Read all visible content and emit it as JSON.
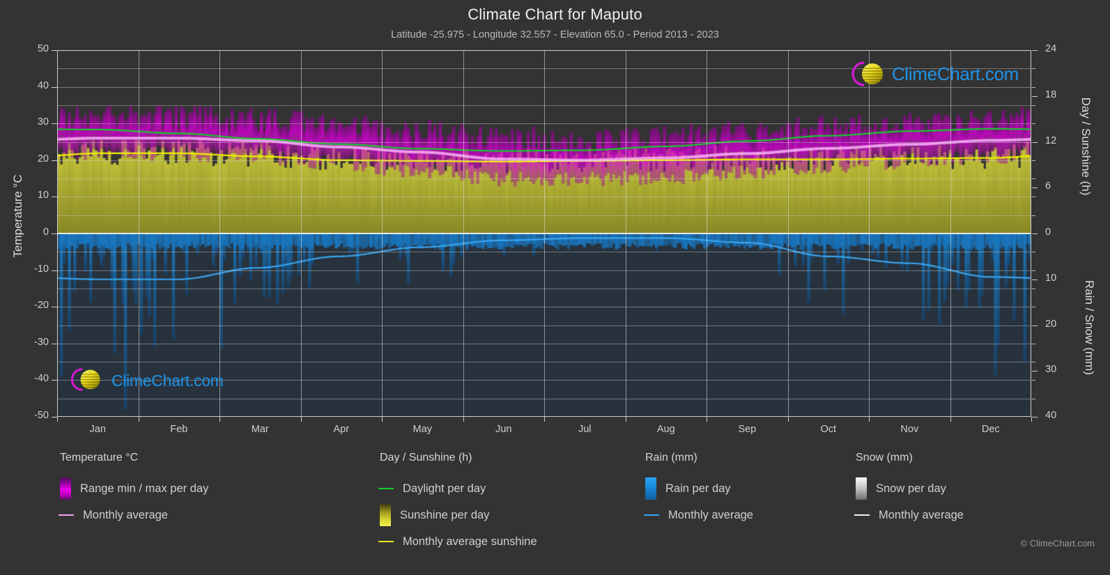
{
  "header": {
    "title": "Climate Chart for Maputo",
    "subtitle": "Latitude -25.975 - Longitude 32.557 - Elevation 65.0 - Period 2013 - 2023"
  },
  "watermark": {
    "text": "ClimeChart.com"
  },
  "copyright": "© ClimeChart.com",
  "axes": {
    "left_label": "Temperature °C",
    "right_label_top": "Day / Sunshine (h)",
    "right_label_bottom": "Rain / Snow (mm)",
    "left_ticks": [
      "50",
      "40",
      "30",
      "20",
      "10",
      "0",
      "-10",
      "-20",
      "-30",
      "-40",
      "-50"
    ],
    "right_ticks_top": [
      "24",
      "18",
      "12",
      "6",
      "0"
    ],
    "right_ticks_bottom": [
      "10",
      "20",
      "30",
      "40"
    ],
    "months": [
      "Jan",
      "Feb",
      "Mar",
      "Apr",
      "May",
      "Jun",
      "Jul",
      "Aug",
      "Sep",
      "Oct",
      "Nov",
      "Dec"
    ]
  },
  "legend": {
    "groups": [
      {
        "title": "Temperature °C",
        "items": [
          {
            "label": "Range min / max per day",
            "swatch": "gradient-magenta",
            "color": "#e000e0"
          },
          {
            "label": "Monthly average",
            "swatch": "line",
            "color": "#f2a6f2"
          }
        ]
      },
      {
        "title": "Day / Sunshine (h)",
        "items": [
          {
            "label": "Daylight per day",
            "swatch": "line",
            "color": "#16cc2a"
          },
          {
            "label": "Sunshine per day",
            "swatch": "gradient-yellow",
            "color": "#e8e83c"
          },
          {
            "label": "Monthly average sunshine",
            "swatch": "line",
            "color": "#e8e820"
          }
        ]
      },
      {
        "title": "Rain (mm)",
        "items": [
          {
            "label": "Rain per day",
            "swatch": "gradient-blue",
            "color": "#1790e0"
          },
          {
            "label": "Monthly average",
            "swatch": "line",
            "color": "#3aa6f0"
          }
        ]
      },
      {
        "title": "Snow (mm)",
        "items": [
          {
            "label": "Snow per day",
            "swatch": "gradient-white",
            "color": "#e8e8e8"
          },
          {
            "label": "Monthly average",
            "swatch": "line",
            "color": "#f0f0f0"
          }
        ]
      }
    ]
  },
  "colors": {
    "background": "#333333",
    "grid": "#d7d7d7",
    "temp_range": "#cc00cc",
    "temp_avg": "#f2a6f2",
    "daylight": "#16cc2a",
    "sunshine_fill": "#a8a82c",
    "sunshine_avg": "#f0f000",
    "rain": "#1f6fa8",
    "rain_avg": "#3aa6f0",
    "text": "#d0d0d0"
  },
  "chart_data": {
    "type": "area",
    "title": "Climate Chart for Maputo",
    "subtitle": "Latitude -25.975 - Longitude 32.557 - Elevation 65.0 - Period 2013 - 2023",
    "xlabel": "",
    "ylabel": "Temperature °C",
    "ylim": [
      -50,
      50
    ],
    "y2lim_top": [
      0,
      24
    ],
    "y2lim_bottom": [
      0,
      40
    ],
    "grid": true,
    "legend_position": "bottom",
    "categories": [
      "Jan",
      "Feb",
      "Mar",
      "Apr",
      "May",
      "Jun",
      "Jul",
      "Aug",
      "Sep",
      "Oct",
      "Nov",
      "Dec"
    ],
    "series": [
      {
        "name": "Temperature monthly average",
        "unit": "°C",
        "axis": "left",
        "color": "#f2a6f2",
        "values": [
          26.0,
          26.0,
          25.3,
          23.6,
          22.2,
          20.3,
          20.0,
          20.6,
          21.8,
          23.2,
          24.3,
          25.4
        ]
      },
      {
        "name": "Temperature daily max (range top)",
        "unit": "°C",
        "axis": "left",
        "color": "#cc00cc",
        "values": [
          31.0,
          31.0,
          30.2,
          28.6,
          27.2,
          25.4,
          25.0,
          25.8,
          27.0,
          28.2,
          29.2,
          30.4
        ]
      },
      {
        "name": "Temperature daily min (range bottom)",
        "unit": "°C",
        "axis": "left",
        "color": "#cc00cc",
        "values": [
          22.5,
          22.5,
          21.7,
          19.8,
          17.8,
          15.6,
          15.2,
          16.0,
          17.4,
          19.0,
          20.4,
          21.8
        ]
      },
      {
        "name": "Daylight per day",
        "unit": "h",
        "axis": "right-top",
        "color": "#16cc2a",
        "values": [
          13.6,
          13.1,
          12.4,
          11.7,
          11.1,
          10.8,
          10.9,
          11.4,
          12.1,
          12.8,
          13.4,
          13.7
        ]
      },
      {
        "name": "Monthly average sunshine",
        "unit": "h",
        "axis": "right-top",
        "color": "#f0f000",
        "values": [
          10.5,
          10.5,
          10.1,
          9.6,
          9.5,
          9.4,
          9.5,
          9.6,
          9.7,
          9.7,
          9.8,
          9.9
        ]
      },
      {
        "name": "Rain monthly average",
        "unit": "mm",
        "axis": "right-bottom",
        "color": "#3aa6f0",
        "values": [
          10.0,
          10.0,
          7.5,
          5.0,
          3.0,
          1.5,
          1.0,
          1.0,
          2.0,
          5.0,
          6.5,
          9.5
        ]
      },
      {
        "name": "Snow monthly average",
        "unit": "mm",
        "axis": "right-bottom",
        "color": "#f0f0f0",
        "values": [
          0,
          0,
          0,
          0,
          0,
          0,
          0,
          0,
          0,
          0,
          0,
          0
        ]
      }
    ]
  }
}
